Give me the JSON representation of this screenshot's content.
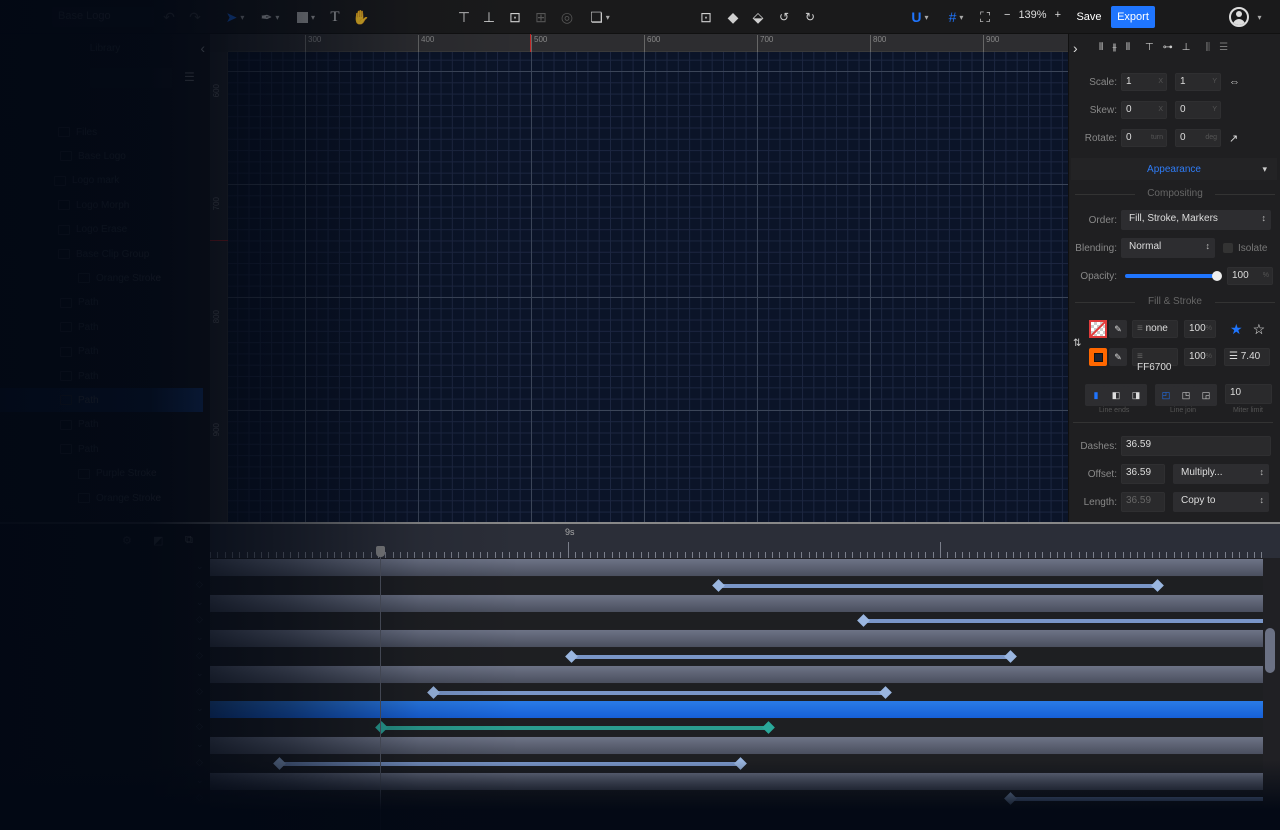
{
  "topbar": {
    "doc_title": "Base Logo",
    "undo_icon": "undo-icon",
    "redo_icon": "redo-icon",
    "tools": [
      "select-tool",
      "pen-tool",
      "shape-tool",
      "text-tool",
      "hand-tool"
    ],
    "text_tool_glyph": "T",
    "zoom": {
      "minus": "−",
      "value": "139%",
      "plus": "+"
    },
    "save_label": "Save",
    "export_label": "Export",
    "accent_color": "#1f75fe"
  },
  "library": {
    "title": "Library",
    "layers": [
      {
        "label": "Files"
      },
      {
        "label": "Base Logo"
      },
      {
        "label": "Logo mark"
      },
      {
        "label": "Logo Morph"
      },
      {
        "label": "Logo Erase"
      },
      {
        "label": "Base Clip Group"
      },
      {
        "label": "Orange Stroke"
      },
      {
        "label": "Path"
      },
      {
        "label": "Path"
      },
      {
        "label": "Path"
      },
      {
        "label": "Path"
      },
      {
        "label": "Path",
        "selected": true
      },
      {
        "label": "Path"
      },
      {
        "label": "Path"
      },
      {
        "label": "Purple Stroke"
      },
      {
        "label": "Orange Stroke"
      }
    ]
  },
  "canvas": {
    "h_ruler": [
      "300",
      "400",
      "500",
      "600",
      "700",
      "800",
      "900"
    ],
    "v_ruler": [
      "600",
      "700",
      "800",
      "900"
    ]
  },
  "props": {
    "scale": {
      "label": "Scale:",
      "x": "1",
      "y": "1",
      "x_unit": "X",
      "y_unit": "Y"
    },
    "skew": {
      "label": "Skew:",
      "x": "0",
      "y": "0",
      "x_unit": "X",
      "y_unit": "Y"
    },
    "rotate": {
      "label": "Rotate:",
      "x": "0",
      "y": "0",
      "x_unit": "turn",
      "y_unit": "deg"
    },
    "appearance_tab": "Appearance",
    "compositing_title": "Compositing",
    "order": {
      "label": "Order:",
      "value": "Fill, Stroke, Markers"
    },
    "blending": {
      "label": "Blending:",
      "value": "Normal",
      "isolate_label": "Isolate",
      "isolate_checked": false
    },
    "opacity": {
      "label": "Opacity:",
      "value": "100",
      "unit": "%",
      "fraction": 1.0
    },
    "fill_stroke_title": "Fill & Stroke",
    "fill": {
      "color": "none",
      "opacity": "100",
      "unit": "%"
    },
    "stroke": {
      "color": "FF6700",
      "opacity": "100",
      "unit": "%",
      "width": "7.40",
      "swatch": "#ff6700"
    },
    "line_ends_label": "Line ends",
    "line_join_label": "Line join",
    "miter": {
      "value": "10",
      "label": "Miter limit"
    },
    "dashes": {
      "label": "Dashes:",
      "value": "36.59"
    },
    "offset": {
      "label": "Offset:",
      "value": "36.59",
      "op": "Multiply..."
    },
    "length": {
      "label": "Length:",
      "value": "36.59",
      "op": "Copy to"
    }
  },
  "timeline": {
    "time_label": "9s",
    "rows": [
      {
        "kind": "light"
      },
      {
        "kind": "dark",
        "kf": [
          718,
          1157
        ],
        "color": "#7a96c8"
      },
      {
        "kind": "light"
      },
      {
        "kind": "dark",
        "kf": [
          863,
          1263
        ],
        "color": "#7a96c8"
      },
      {
        "kind": "light"
      },
      {
        "kind": "dark",
        "kf": [
          571,
          1010
        ],
        "color": "#7a96c8"
      },
      {
        "kind": "light"
      },
      {
        "kind": "dark",
        "kf": [
          433,
          885
        ],
        "color": "#7a96c8"
      },
      {
        "kind": "selected"
      },
      {
        "kind": "dark",
        "kf": [
          381,
          768
        ],
        "color": "#2a9d8f"
      },
      {
        "kind": "light"
      },
      {
        "kind": "dark",
        "kf": [
          279,
          740
        ],
        "color": "#7a96c8"
      },
      {
        "kind": "light"
      },
      {
        "kind": "dark",
        "kf": [
          1010,
          1263
        ],
        "color": "#7a96c8"
      }
    ]
  }
}
